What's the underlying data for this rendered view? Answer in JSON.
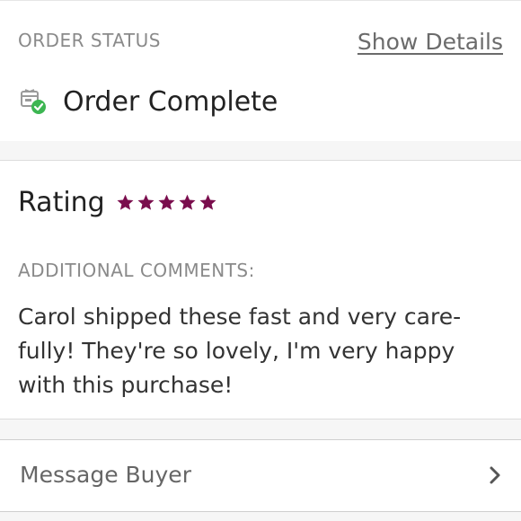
{
  "order_status": {
    "label": "ORDER STATUS",
    "show_details": "Show Details",
    "status_text": "Order Complete",
    "status_icon": "order-complete-icon",
    "status_color": "#3db652"
  },
  "rating": {
    "title": "Rating",
    "stars": 5,
    "max_stars": 5,
    "star_color": "#7a0d4d"
  },
  "comments": {
    "label": "ADDITIONAL COMMENTS:",
    "text": "Carol shipped these fast and very care-fully! They're so lovely, I'm very happy with this purchase!"
  },
  "message": {
    "label": "Message Buyer",
    "icon": "chevron-right-icon"
  }
}
